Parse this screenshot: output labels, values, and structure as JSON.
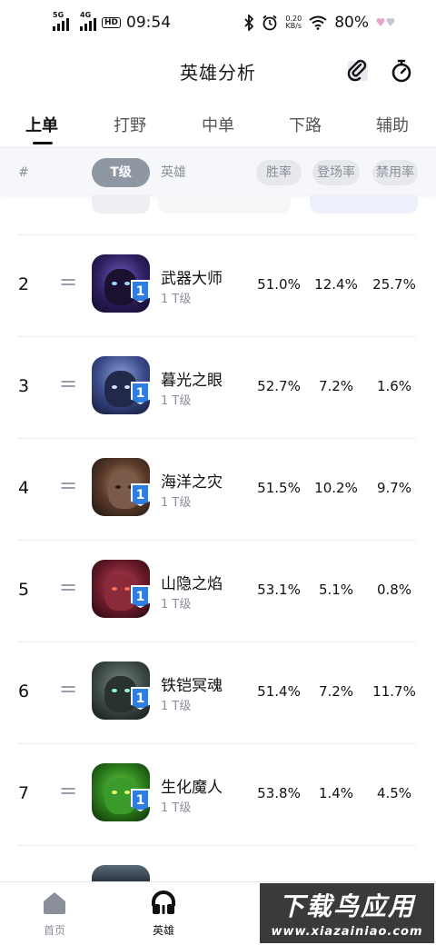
{
  "status_bar": {
    "net1": "5G",
    "net2": "4G",
    "hd": "HD",
    "time": "09:54",
    "speed_value": "0.20",
    "speed_unit": "KB/s",
    "battery": "80%"
  },
  "header": {
    "title": "英雄分析",
    "clip_icon": "paperclip-icon",
    "timer_icon": "stopwatch-icon"
  },
  "tabs": [
    {
      "label": "上单",
      "active": true
    },
    {
      "label": "打野",
      "active": false
    },
    {
      "label": "中单",
      "active": false
    },
    {
      "label": "下路",
      "active": false
    },
    {
      "label": "辅助",
      "active": false
    }
  ],
  "columns": {
    "rank": "#",
    "tier": "T级",
    "hero": "英雄",
    "win_rate": "胜率",
    "pick_rate": "登场率",
    "ban_rate": "禁用率"
  },
  "rows": [
    {
      "rank": "2",
      "trend": "=",
      "badge": "1",
      "name": "武器大师",
      "tier": "1 T级",
      "win": "51.0%",
      "pick": "12.4%",
      "ban": "25.7%"
    },
    {
      "rank": "3",
      "trend": "=",
      "badge": "1",
      "name": "暮光之眼",
      "tier": "1 T级",
      "win": "52.7%",
      "pick": "7.2%",
      "ban": "1.6%"
    },
    {
      "rank": "4",
      "trend": "=",
      "badge": "1",
      "name": "海洋之灾",
      "tier": "1 T级",
      "win": "51.5%",
      "pick": "10.2%",
      "ban": "9.7%"
    },
    {
      "rank": "5",
      "trend": "=",
      "badge": "1",
      "name": "山隐之焰",
      "tier": "1 T级",
      "win": "53.1%",
      "pick": "5.1%",
      "ban": "0.8%"
    },
    {
      "rank": "6",
      "trend": "=",
      "badge": "1",
      "name": "铁铠冥魂",
      "tier": "1 T级",
      "win": "51.4%",
      "pick": "7.2%",
      "ban": "11.7%"
    },
    {
      "rank": "7",
      "trend": "=",
      "badge": "1",
      "name": "生化魔人",
      "tier": "1 T级",
      "win": "53.8%",
      "pick": "1.4%",
      "ban": "4.5%"
    }
  ],
  "bottom_nav": [
    {
      "label": "首页",
      "icon": "home-icon",
      "active": false
    },
    {
      "label": "英雄",
      "icon": "headphones-icon",
      "active": true
    }
  ],
  "watermark": {
    "title": "下载鸟应用",
    "url": "www.xiazainiao.com"
  },
  "colors": {
    "accent": "#111111",
    "tier_pill": "#8f97a3",
    "badge_blue": "#2f7de1",
    "muted": "#8a8f99"
  }
}
